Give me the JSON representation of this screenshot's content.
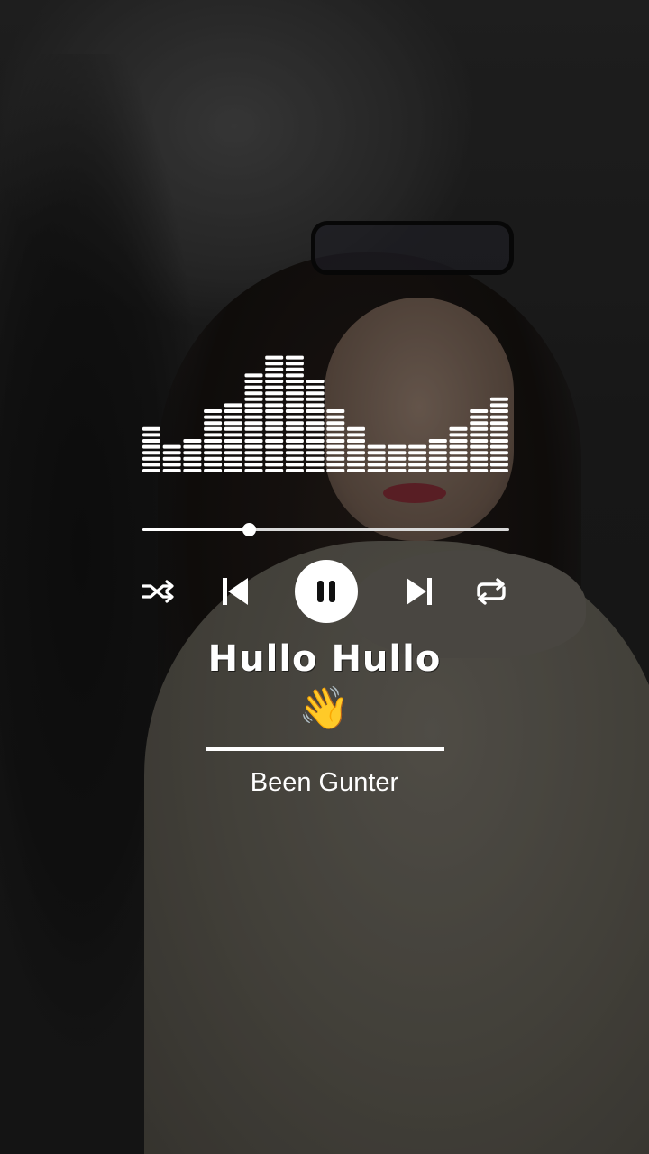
{
  "player": {
    "song_title": "Hullo Hullo",
    "emoji": "👋",
    "artist": "Been Gunter",
    "progress": 0.29,
    "state": "playing",
    "controls": {
      "shuffle_icon": "shuffle-icon",
      "previous_icon": "skip-previous-icon",
      "pause_icon": "pause-icon",
      "next_icon": "skip-next-icon",
      "repeat_icon": "repeat-icon"
    },
    "equalizer_levels": [
      0.36,
      0.26,
      0.29,
      0.52,
      0.57,
      0.82,
      0.96,
      0.93,
      0.76,
      0.5,
      0.4,
      0.26,
      0.23,
      0.26,
      0.3,
      0.36,
      0.52,
      0.6
    ]
  },
  "colors": {
    "foreground": "#ffffff",
    "background": "#1c1c1c"
  }
}
